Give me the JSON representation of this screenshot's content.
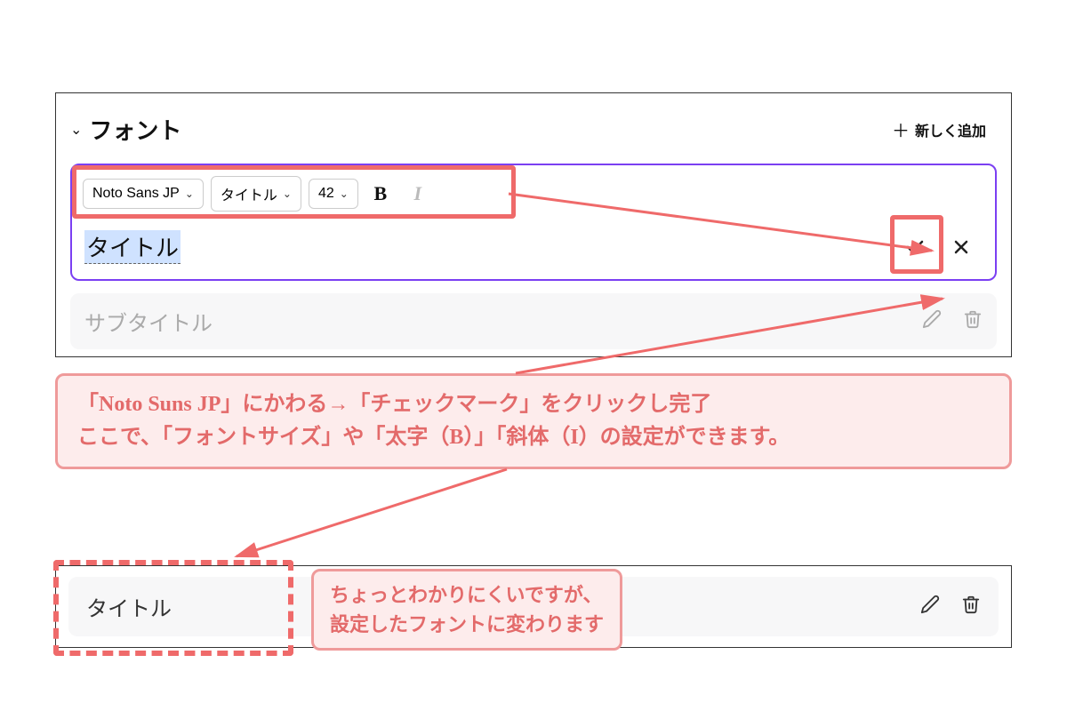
{
  "section": {
    "title": "フォント",
    "add_label": "新しく追加"
  },
  "toolbar": {
    "font_family": "Noto Sans JP",
    "style_preset": "タイトル",
    "font_size": "42",
    "bold_label": "B",
    "italic_label": "I"
  },
  "edit_item": {
    "text": "タイトル"
  },
  "secondary_item": {
    "text": "サブタイトル"
  },
  "result_item": {
    "text": "タイトル"
  },
  "annotations": {
    "main_line1": "「Noto Suns JP」にかわる→「チェックマーク」をクリックし完了",
    "main_line2": "ここで、「フォントサイズ」や「太字（B）」「斜体（I）の設定ができます。",
    "small_line1": "ちょっとわかりにくいですが、",
    "small_line2": "設定したフォントに変わります"
  },
  "colors": {
    "highlight_border": "#ef6a6a",
    "annotation_bg": "#fdecec",
    "annotation_text": "#e36a6a",
    "card_border": "#7b3ff2",
    "selection_bg": "#cfe2ff"
  }
}
